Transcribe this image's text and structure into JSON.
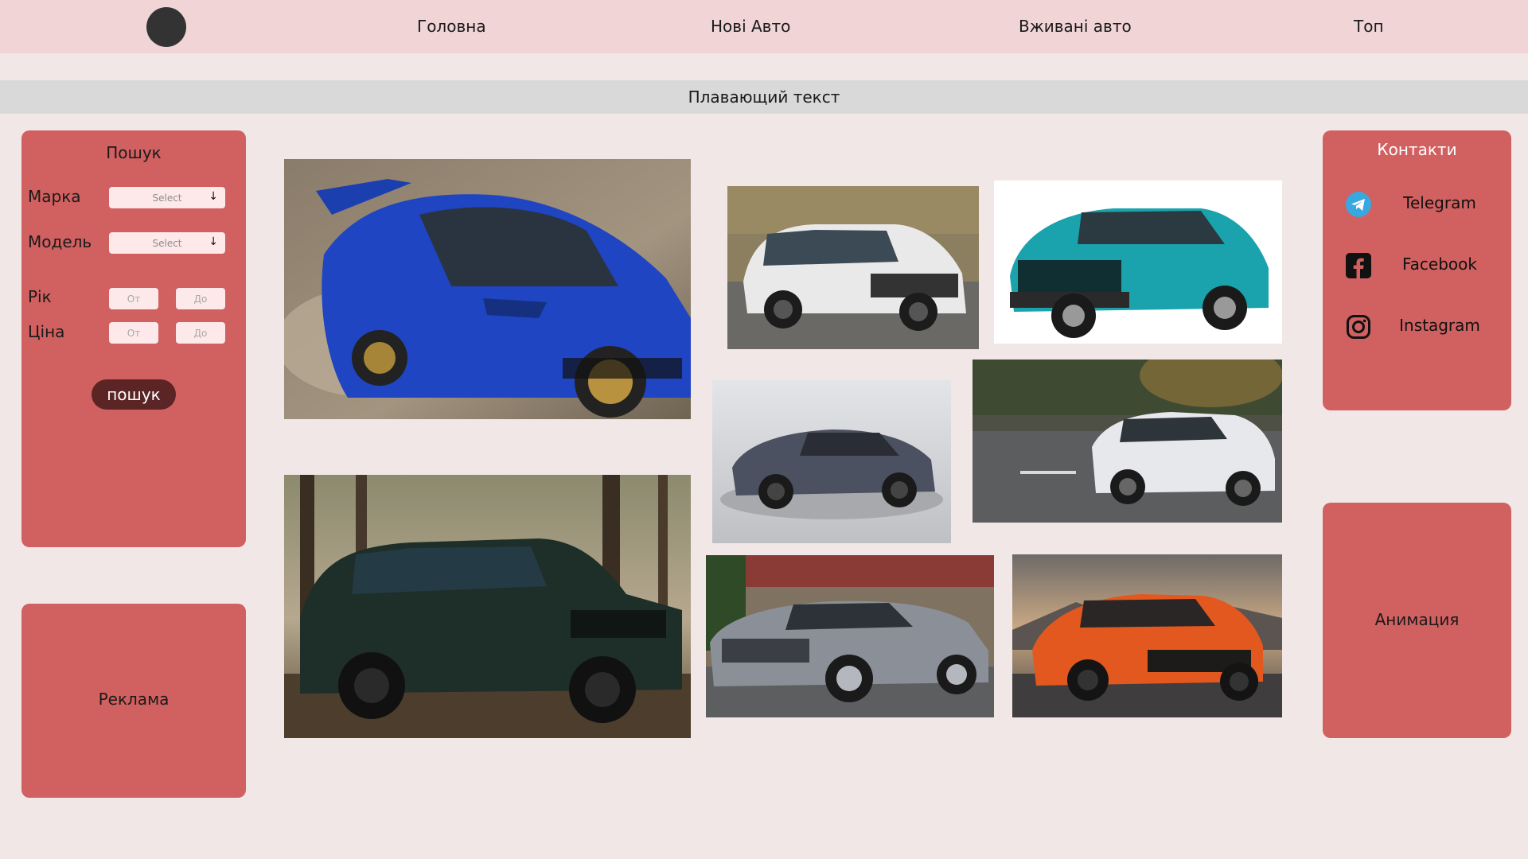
{
  "nav": {
    "home": "Головна",
    "new_cars": "Нові Авто",
    "used_cars": "Вживані авто",
    "top": "Топ"
  },
  "marquee": {
    "text": "Плавающий текст"
  },
  "search": {
    "title": "Пошук",
    "brand_label": "Марка",
    "brand_placeholder": "Select",
    "model_label": "Модель",
    "model_placeholder": "Select",
    "year_label": "Рік",
    "year_from": "От",
    "year_to": "До",
    "price_label": "Ціна",
    "price_from": "От",
    "price_to": "До",
    "button": "пошук"
  },
  "ad": {
    "label": "Реклама"
  },
  "contacts": {
    "title": "Контакти",
    "items": [
      {
        "label": "Telegram",
        "icon": "telegram-icon"
      },
      {
        "label": "Facebook",
        "icon": "facebook-icon"
      },
      {
        "label": "Instagram",
        "icon": "instagram-icon"
      }
    ]
  },
  "animation": {
    "label": "Анимация"
  },
  "colors": {
    "nav_bg": "#f0d4d6",
    "page_bg": "#f2e7e7",
    "panel": "#d16060",
    "button": "#5b2425",
    "marquee_bg": "#d9d9d9"
  }
}
